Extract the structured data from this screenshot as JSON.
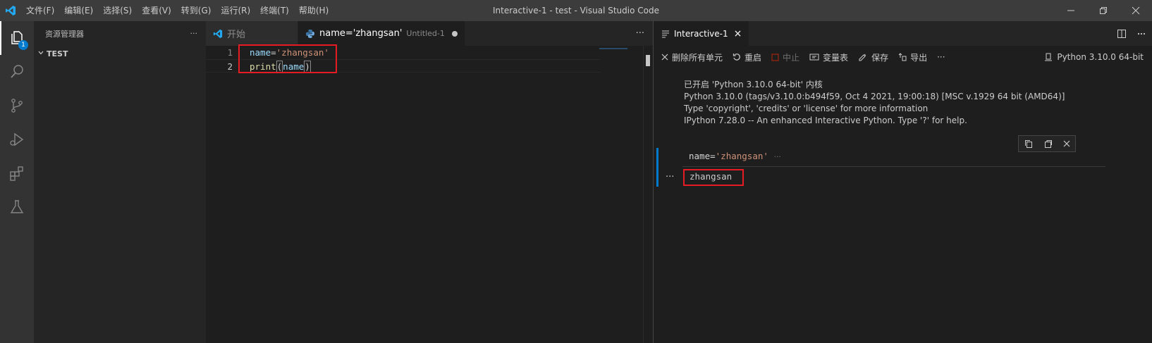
{
  "window": {
    "title": "Interactive-1 - test - Visual Studio Code"
  },
  "menu": [
    "文件(F)",
    "编辑(E)",
    "选择(S)",
    "查看(V)",
    "转到(G)",
    "运行(R)",
    "终端(T)",
    "帮助(H)"
  ],
  "activity_bar": {
    "explorer_badge": "1"
  },
  "sidebar": {
    "title": "资源管理器",
    "more": "···",
    "section": "TEST"
  },
  "editor": {
    "tabs": [
      {
        "label": "开始",
        "description": ""
      },
      {
        "label": "name='zhangsan'",
        "description": "Untitled-1"
      }
    ],
    "more": "···",
    "lines": [
      {
        "number": "1",
        "tokens": [
          "name",
          "=",
          "'zhangsan'"
        ]
      },
      {
        "number": "2",
        "tokens": [
          "print",
          "(",
          "name",
          ")"
        ]
      }
    ]
  },
  "interactive": {
    "tab_label": "Interactive-1",
    "close": "×",
    "toolbar": {
      "clear_all": "删除所有单元",
      "restart": "重启",
      "interrupt": "中止",
      "variables": "变量表",
      "save": "保存",
      "export": "导出",
      "more": "···"
    },
    "kernel": "Python 3.10.0 64-bit",
    "banner": [
      "已开启 'Python 3.10.0 64-bit' 内核",
      "Python 3.10.0 (tags/v3.10.0:b494f59, Oct 4 2021, 19:00:18) [MSC v.1929 64 bit (AMD64)]",
      "Type 'copyright', 'credits' or 'license' for more information",
      "IPython 7.28.0 -- An enhanced Interactive Python. Type '?' for help."
    ],
    "cell": {
      "input_tokens": [
        "name",
        "=",
        "'zhangsan'"
      ],
      "input_ellipsis": "···",
      "output_dots": "···",
      "output": "zhangsan"
    }
  },
  "colors": {
    "accent": "#007acc",
    "highlight_box": "#e51c23"
  }
}
